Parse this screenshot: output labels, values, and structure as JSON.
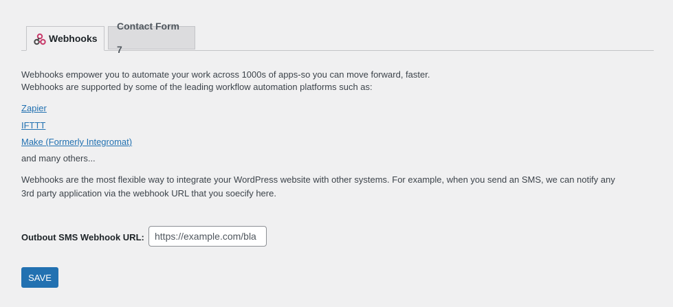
{
  "tabs": [
    {
      "label": "Webhooks",
      "icon": "webhook-icon",
      "active": true
    },
    {
      "label": "Contact Form 7",
      "active": false
    }
  ],
  "intro": {
    "line1": "Webhooks empower you to automate your work across 1000s of apps-so you can move forward, faster.",
    "line2": "Webhooks are supported by some of the leading workflow automation platforms such as:"
  },
  "platforms": [
    {
      "label": "Zapier"
    },
    {
      "label": "IFTTT"
    },
    {
      "label": "Make (Formerly Integromat)"
    }
  ],
  "others_text": "and many others...",
  "description": {
    "line1": "Webhooks are the most flexible way to integrate your WordPress website with other systems. For example, when you send an SMS, we can notify any",
    "line2": "3rd party application via the webhook URL that you soecify here."
  },
  "form": {
    "url_label": "Outbout SMS Webhook URL:",
    "url_placeholder": "https://example.com/bla",
    "save_label": "SAVE"
  },
  "colors": {
    "accent": "#2271b1",
    "background": "#f0f0f1",
    "text": "#3c434a"
  }
}
